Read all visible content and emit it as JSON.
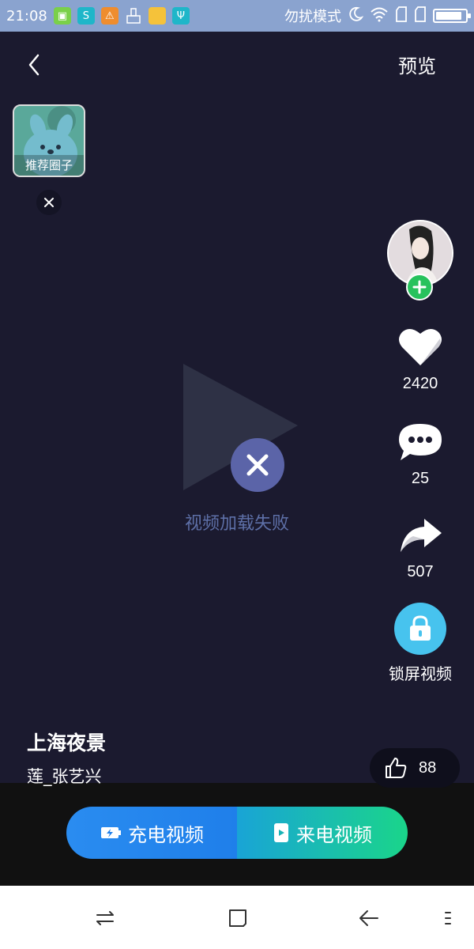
{
  "status_bar": {
    "time": "21:08",
    "mode": "勿扰模式",
    "battery_level": 0.9,
    "icons": [
      "android-icon",
      "s-app-icon",
      "warning-icon",
      "brush-icon",
      "folder-icon",
      "usb-icon",
      "moon-icon",
      "wifi-icon",
      "sim-icon",
      "sim-icon",
      "battery-icon"
    ]
  },
  "header": {
    "back_icon": "chevron-left-icon",
    "preview_label": "预览"
  },
  "circle_card": {
    "label": "推荐圈子",
    "close_icon": "close-icon"
  },
  "player": {
    "error_text": "视频加载失败",
    "play_icon": "play-icon",
    "error_icon": "close-circle-icon"
  },
  "sidebar": {
    "follow_icon": "plus-icon",
    "likes": "2420",
    "comments": "25",
    "shares": "507",
    "lock_label": "锁屏视频"
  },
  "video": {
    "title": "上海夜景",
    "author": "莲_张艺兴",
    "thumbs_count": "88"
  },
  "actions": {
    "charge_label": "充电视频",
    "ring_label": "来电视频"
  },
  "colors": {
    "background": "#1b1a2f",
    "status_bar": "#8aa3cf",
    "follow_green": "#27c25c",
    "lock_blue": "#47c3ee",
    "error_circle": "#5b64a8",
    "error_text": "#5e70a8"
  }
}
